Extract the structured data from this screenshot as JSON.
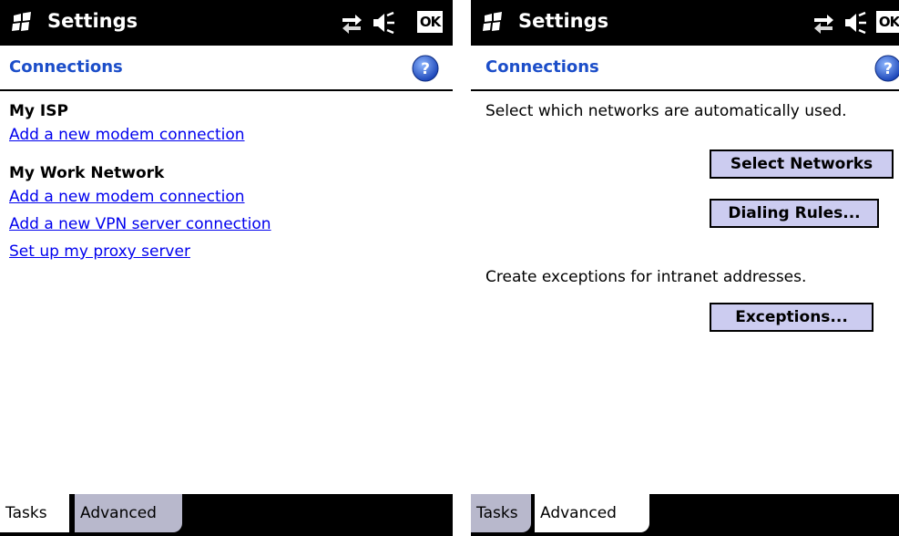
{
  "panels": [
    {
      "title": "Settings",
      "header": "Connections",
      "ok_label": "OK",
      "groups": [
        {
          "heading": "My ISP",
          "links": [
            "Add a new modem connection"
          ]
        },
        {
          "heading": "My Work Network",
          "links": [
            "Add a new modem connection",
            "Add a new VPN server connection",
            "Set up my proxy server"
          ]
        }
      ],
      "tabs": [
        {
          "label": "Tasks",
          "active": true
        },
        {
          "label": "Advanced",
          "active": false
        }
      ]
    },
    {
      "title": "Settings",
      "header": "Connections",
      "ok_label": "OK",
      "networks_text": "Select which networks are automatically used.",
      "select_networks_label": "Select Networks",
      "dialing_rules_label": "Dialing Rules...",
      "exceptions_text": "Create exceptions for intranet addresses.",
      "exceptions_label": "Exceptions...",
      "tabs": [
        {
          "label": "Tasks",
          "active": false
        },
        {
          "label": "Advanced",
          "active": true
        }
      ]
    }
  ],
  "colors": {
    "title_bar": "#000000",
    "header_text": "#1c4ec9",
    "link": "#0000ee",
    "button_face": "#ccccf0",
    "inactive_tab": "#b8b8cc"
  },
  "icons": [
    "windows-logo-icon",
    "connectivity-icon",
    "volume-icon",
    "help-icon"
  ]
}
